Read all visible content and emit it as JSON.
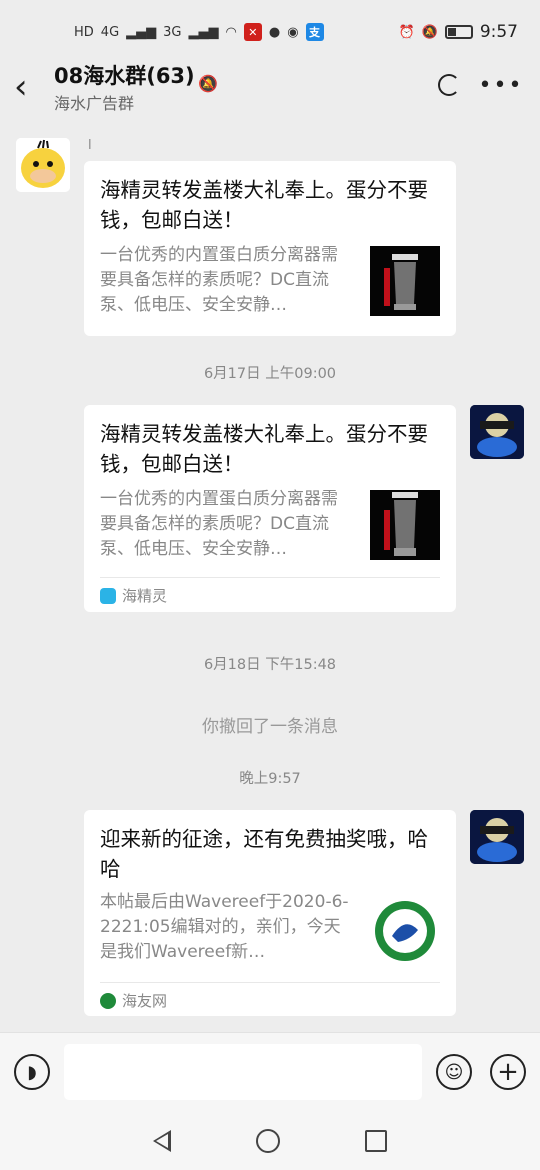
{
  "status_bar": {
    "hd_label": "HD",
    "net1": "4G",
    "net2": "3G",
    "time": "9:57"
  },
  "header": {
    "title": "08海水群(63)",
    "subtitle": "海水广告群",
    "mute_icon": "bell-off-icon"
  },
  "messages": {
    "m1": {
      "sender": "l",
      "title": "海精灵转发盖楼大礼奉上。蛋分不要钱，包邮白送！",
      "desc": "一台优秀的内置蛋白质分离器需要具备怎样的素质呢？DC直流泵、低电压、安全安静…"
    },
    "ts1": "6月17日 上午09:00",
    "m2": {
      "title": "海精灵转发盖楼大礼奉上。蛋分不要钱，包邮白送！",
      "desc": "一台优秀的内置蛋白质分离器需要具备怎样的素质呢？DC直流泵、低电压、安全安静…",
      "source": "海精灵"
    },
    "ts2": "6月18日 下午15:48",
    "recall": "你撤回了一条消息",
    "ts3": "晚上9:57",
    "m3": {
      "title": "迎来新的征途，还有免费抽奖哦，哈哈",
      "desc": "本帖最后由Wavereef于2020-6-2221:05编辑对的，亲们，今天是我们Wavereef新…",
      "source": "海友网"
    }
  },
  "input": {
    "placeholder": ""
  },
  "colors": {
    "background": "#ededed",
    "card": "#ffffff",
    "muted_text": "#888888"
  }
}
